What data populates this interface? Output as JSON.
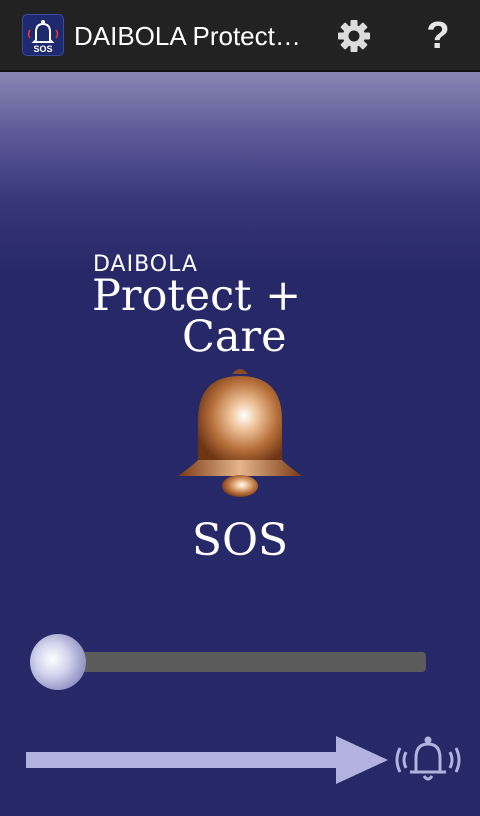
{
  "appbar": {
    "title": "DAIBOLA Protect + Care",
    "icon_label": "SOS",
    "settings_icon": "gear-icon",
    "help_icon": "help-icon",
    "help_glyph": "?"
  },
  "logo": {
    "brand": "DAIBOLA",
    "line1": "Protect +",
    "line2": "Care"
  },
  "sos": {
    "label": "SOS"
  },
  "slider": {
    "value": 0
  },
  "colors": {
    "appbar_bg": "#222222",
    "content_bg": "#272867",
    "bell_copper": "#b7703b",
    "arrow": "#b3b1dd",
    "track": "#5b5b5b"
  }
}
